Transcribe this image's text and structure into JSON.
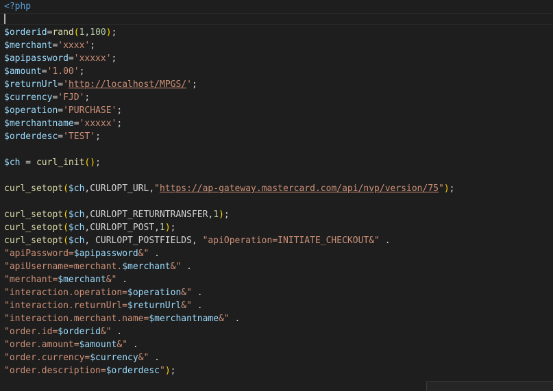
{
  "editor": {
    "php_open": "<?php",
    "code": {
      "orderid": [
        "$orderid",
        "=",
        "rand",
        "(",
        "1",
        ",",
        "100",
        ")",
        ";"
      ],
      "merchant": [
        "$merchant",
        "=",
        "'xxxx'",
        ";"
      ],
      "apipassword": [
        "$apipassword",
        "=",
        "'xxxxx'",
        ";"
      ],
      "amount": [
        "$amount",
        "=",
        "'1.00'",
        ";"
      ],
      "returnUrl": [
        "$returnUrl",
        "=",
        "'",
        "http://localhost/MPGS/",
        "'",
        ";"
      ],
      "currency": [
        "$currency",
        "=",
        "'FJD'",
        ";"
      ],
      "operation": [
        "$operation",
        "=",
        "'PURCHASE'",
        ";"
      ],
      "merchantname": [
        "$merchantname",
        "=",
        "'xxxxx'",
        ";"
      ],
      "orderdesc": [
        "$orderdesc",
        "=",
        "'TEST'",
        ";"
      ],
      "ch_init": [
        "$ch",
        " = ",
        "curl_init",
        "(",
        ")",
        ";"
      ],
      "setopt_url": [
        "curl_setopt",
        "(",
        "$ch",
        ",CURLOPT_URL,",
        "\"",
        "https://ap-gateway.mastercard.com/api/nvp/version/75",
        "\"",
        ")",
        ";"
      ],
      "setopt_rt": [
        "curl_setopt",
        "(",
        "$ch",
        ",CURLOPT_RETURNTRANSFER,",
        "1",
        ")",
        ";"
      ],
      "setopt_post": [
        "curl_setopt",
        "(",
        "$ch",
        ",CURLOPT_POST,",
        "1",
        ")",
        ";"
      ],
      "setopt_fields": [
        "curl_setopt",
        "(",
        "$ch",
        ", CURLOPT_POSTFIELDS, ",
        "\"apiOperation=INITIATE_CHECKOUT&\"",
        " ."
      ],
      "l_apiPassword": [
        "\"apiPassword=",
        "$apipassword",
        "&\"",
        " ."
      ],
      "l_apiUsername": [
        "\"apiUsername=merchant.",
        "$merchant",
        "&\"",
        " ."
      ],
      "l_merchant": [
        "\"merchant=",
        "$merchant",
        "&\"",
        " ."
      ],
      "l_operation": [
        "\"interaction.operation=",
        "$operation",
        "&\"",
        " ."
      ],
      "l_returnUrl": [
        "\"interaction.returnUrl=",
        "$returnUrl",
        "&\"",
        " ."
      ],
      "l_mname": [
        "\"interaction.merchant.name=",
        "$merchantname",
        "&\"",
        " ."
      ],
      "l_orderid": [
        "\"order.id=",
        "$orderid",
        "&\"",
        " ."
      ],
      "l_amount": [
        "\"order.amount=",
        "$amount",
        "&\"",
        " ."
      ],
      "l_currency": [
        "\"order.currency=",
        "$currency",
        "&\"",
        " ."
      ],
      "l_desc": [
        "\"order.description=",
        "$orderdesc",
        "\"",
        ")",
        ";"
      ]
    }
  }
}
